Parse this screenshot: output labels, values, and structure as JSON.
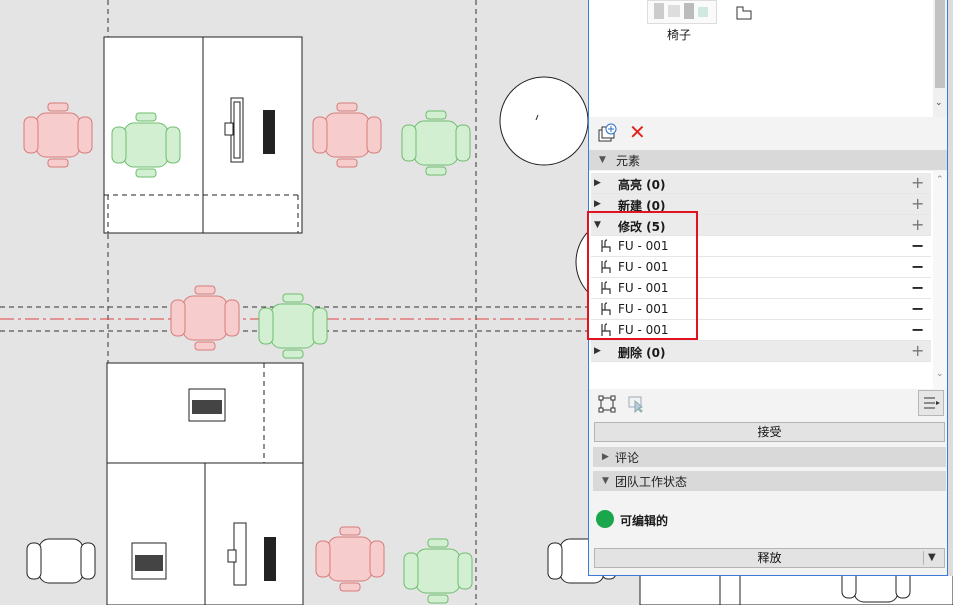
{
  "library": {
    "thumb_label": "椅子"
  },
  "toolbar": {
    "add_icon": "add-layer-icon",
    "delete_icon": "close-icon"
  },
  "elements_section": {
    "title": "元素",
    "groups": [
      {
        "label": "高亮 (0)",
        "expanded": false,
        "action": "+"
      },
      {
        "label": "新建 (0)",
        "expanded": false,
        "action": "+"
      },
      {
        "label": "修改 (5)",
        "expanded": true,
        "action": "+"
      },
      {
        "label": "删除 (0)",
        "expanded": false,
        "action": "+"
      }
    ],
    "modified_items": [
      {
        "label": "FU - 001",
        "action": "−"
      },
      {
        "label": "FU - 001",
        "action": "−"
      },
      {
        "label": "FU - 001",
        "action": "−"
      },
      {
        "label": "FU - 001",
        "action": "−"
      },
      {
        "label": "FU - 001",
        "action": "−"
      }
    ]
  },
  "accept_button": "接受",
  "comments_section": {
    "title": "评论"
  },
  "team_section": {
    "title": "团队工作状态",
    "status_label": "可编辑的",
    "status_color": "#1aa64b",
    "release_button": "释放"
  },
  "colors": {
    "highlight_box": "#e0141e",
    "panel_border": "#3a7bd5",
    "chair_red": "#f5c9c9",
    "chair_green": "#cdebcd"
  }
}
